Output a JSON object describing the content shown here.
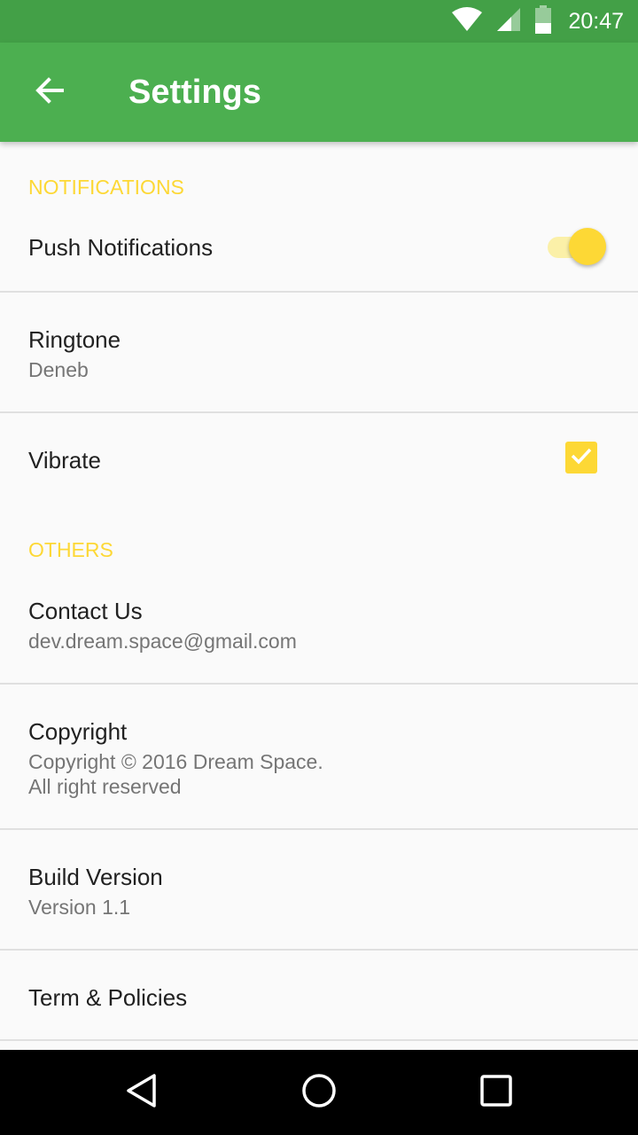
{
  "status_bar": {
    "time": "20:47",
    "icons": [
      "wifi-icon",
      "cell-signal-icon",
      "battery-icon"
    ]
  },
  "app_bar": {
    "title": "Settings",
    "back_icon": "arrow-back-icon"
  },
  "sections": {
    "notifications": {
      "header": "NOTIFICATIONS",
      "push": {
        "title": "Push Notifications",
        "enabled": true
      },
      "ringtone": {
        "title": "Ringtone",
        "value": "Deneb"
      },
      "vibrate": {
        "title": "Vibrate",
        "checked": true
      }
    },
    "others": {
      "header": "OTHERS",
      "contact": {
        "title": "Contact Us",
        "value": "dev.dream.space@gmail.com"
      },
      "copyright": {
        "title": "Copyright",
        "line1": "Copyright © 2016 Dream Space.",
        "line2": "All right reserved"
      },
      "build": {
        "title": "Build Version",
        "value": "Version 1.1"
      },
      "terms": {
        "title": "Term & Policies"
      }
    }
  },
  "nav_bar": {
    "icons": [
      "nav-back-icon",
      "nav-home-icon",
      "nav-recents-icon"
    ]
  },
  "colors": {
    "primary": "#4caf50",
    "primary_dark": "#43a047",
    "accent": "#fdd835"
  }
}
